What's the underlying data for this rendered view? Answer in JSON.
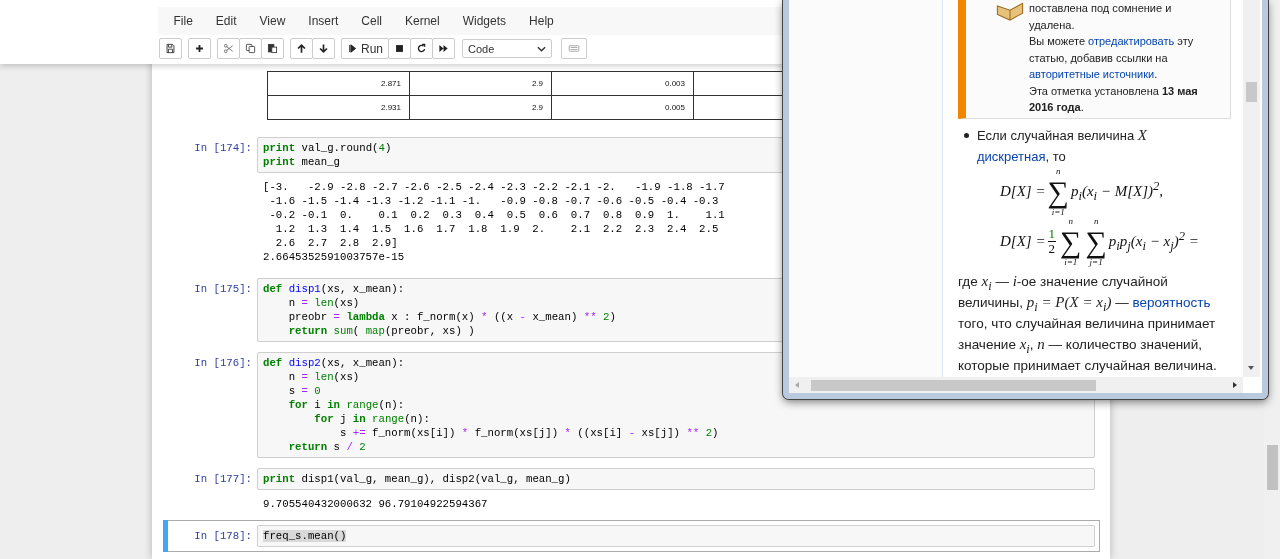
{
  "menu": [
    "File",
    "Edit",
    "View",
    "Insert",
    "Cell",
    "Kernel",
    "Widgets",
    "Help"
  ],
  "toolbar": {
    "groups": [
      [
        {
          "kind": "save"
        }
      ],
      [
        {
          "kind": "add"
        }
      ],
      [
        {
          "kind": "cut"
        },
        {
          "kind": "copy"
        },
        {
          "kind": "paste"
        }
      ],
      [
        {
          "kind": "up"
        },
        {
          "kind": "down"
        }
      ],
      [
        {
          "kind": "run",
          "label": "Run"
        },
        {
          "kind": "stop"
        },
        {
          "kind": "restart"
        },
        {
          "kind": "forward"
        }
      ]
    ],
    "cell_type": {
      "value": "Code"
    },
    "extra": [
      {
        "kind": "keyboard"
      }
    ]
  },
  "table": {
    "rows": [
      [
        "2.871",
        "2.9",
        "0.003"
      ],
      [
        "2.931",
        "2.9",
        "0.005"
      ]
    ]
  },
  "cells": [
    {
      "prompt": "In [174]:",
      "selected": false,
      "code": [
        [
          {
            "kind": "kw",
            "text": "print"
          },
          {
            "kind": "t",
            "text": " val_g.round("
          },
          {
            "kind": "num",
            "text": "4"
          },
          {
            "kind": "t",
            "text": ")"
          }
        ],
        [
          {
            "kind": "kw",
            "text": "print"
          },
          {
            "kind": "t",
            "text": " mean_g"
          }
        ]
      ],
      "output": [
        "[-3.   -2.9 -2.8 -2.7 -2.6 -2.5 -2.4 -2.3 -2.2 -2.1 -2.   -1.9 -1.8 -1.7",
        " -1.6 -1.5 -1.4 -1.3 -1.2 -1.1 -1.   -0.9 -0.8 -0.7 -0.6 -0.5 -0.4 -0.3",
        " -0.2 -0.1  0.    0.1  0.2  0.3  0.4  0.5  0.6  0.7  0.8  0.9  1.    1.1",
        "  1.2  1.3  1.4  1.5  1.6  1.7  1.8  1.9  2.    2.1  2.2  2.3  2.4  2.5",
        "  2.6  2.7  2.8  2.9]",
        "2.6645352591003757e-15"
      ]
    },
    {
      "prompt": "In [175]:",
      "selected": false,
      "code": [
        [
          {
            "kind": "kw",
            "text": "def "
          },
          {
            "kind": "fn",
            "text": "disp1"
          },
          {
            "kind": "t",
            "text": "(xs, x_mean):"
          }
        ],
        [
          {
            "kind": "t",
            "text": "    n "
          },
          {
            "kind": "op",
            "text": "= "
          },
          {
            "kind": "bi",
            "text": "len"
          },
          {
            "kind": "t",
            "text": "(xs)"
          }
        ],
        [
          {
            "kind": "t",
            "text": "    preobr "
          },
          {
            "kind": "op",
            "text": "= "
          },
          {
            "kind": "kw",
            "text": "lambda"
          },
          {
            "kind": "t",
            "text": " x : f_norm(x) "
          },
          {
            "kind": "op",
            "text": "*"
          },
          {
            "kind": "t",
            "text": " ((x "
          },
          {
            "kind": "op",
            "text": "-"
          },
          {
            "kind": "t",
            "text": " x_mean) "
          },
          {
            "kind": "op",
            "text": "** "
          },
          {
            "kind": "num",
            "text": "2"
          },
          {
            "kind": "t",
            "text": ")"
          }
        ],
        [
          {
            "kind": "kw",
            "text": "    return "
          },
          {
            "kind": "bi",
            "text": "sum"
          },
          {
            "kind": "t",
            "text": "( "
          },
          {
            "kind": "bi",
            "text": "map"
          },
          {
            "kind": "t",
            "text": "(preobr, xs) )"
          }
        ]
      ]
    },
    {
      "prompt": "In [176]:",
      "selected": false,
      "code": [
        [
          {
            "kind": "kw",
            "text": "def "
          },
          {
            "kind": "fn",
            "text": "disp2"
          },
          {
            "kind": "t",
            "text": "(xs, x_mean):"
          }
        ],
        [
          {
            "kind": "t",
            "text": "    n "
          },
          {
            "kind": "op",
            "text": "= "
          },
          {
            "kind": "bi",
            "text": "len"
          },
          {
            "kind": "t",
            "text": "(xs)"
          }
        ],
        [
          {
            "kind": "t",
            "text": "    s "
          },
          {
            "kind": "op",
            "text": "= "
          },
          {
            "kind": "num",
            "text": "0"
          }
        ],
        [
          {
            "kind": "kw",
            "text": "    for"
          },
          {
            "kind": "t",
            "text": " i "
          },
          {
            "kind": "kw",
            "text": "in "
          },
          {
            "kind": "bi",
            "text": "range"
          },
          {
            "kind": "t",
            "text": "(n):"
          }
        ],
        [
          {
            "kind": "kw",
            "text": "        for"
          },
          {
            "kind": "t",
            "text": " j "
          },
          {
            "kind": "kw",
            "text": "in "
          },
          {
            "kind": "bi",
            "text": "range"
          },
          {
            "kind": "t",
            "text": "(n):"
          }
        ],
        [
          {
            "kind": "t",
            "text": "            s "
          },
          {
            "kind": "op",
            "text": "+="
          },
          {
            "kind": "t",
            "text": " f_norm(xs[i]) "
          },
          {
            "kind": "op",
            "text": "*"
          },
          {
            "kind": "t",
            "text": " f_norm(xs[j]) "
          },
          {
            "kind": "op",
            "text": "*"
          },
          {
            "kind": "t",
            "text": " ((xs[i] "
          },
          {
            "kind": "op",
            "text": "-"
          },
          {
            "kind": "t",
            "text": " xs[j]) "
          },
          {
            "kind": "op",
            "text": "** "
          },
          {
            "kind": "num",
            "text": "2"
          },
          {
            "kind": "t",
            "text": ")"
          }
        ],
        [
          {
            "kind": "kw",
            "text": "    return"
          },
          {
            "kind": "t",
            "text": " s "
          },
          {
            "kind": "op",
            "text": "/ "
          },
          {
            "kind": "num",
            "text": "2"
          }
        ]
      ]
    },
    {
      "prompt": "In [177]:",
      "selected": false,
      "code": [
        [
          {
            "kind": "kw",
            "text": "print"
          },
          {
            "kind": "t",
            "text": " disp1(val_g, mean_g), disp2(val_g, mean_g)"
          }
        ]
      ],
      "output": [
        "9.705540432000632 96.79104922594367"
      ]
    },
    {
      "prompt": "In [178]:",
      "selected": true,
      "code": [
        [
          {
            "kind": "hl",
            "text": "freq_s.mean()"
          }
        ]
      ]
    }
  ],
  "article": {
    "notice": [
      [
        {
          "kind": "text",
          "text": "поставлена под сомнение и удалена."
        }
      ],
      [
        {
          "kind": "text",
          "text": "Вы можете "
        },
        {
          "kind": "link",
          "text": "отредактировать"
        },
        {
          "kind": "text",
          "text": " эту статью, добавив ссылки на "
        },
        {
          "kind": "link",
          "text": "авторитетные источники"
        },
        {
          "kind": "text",
          "text": "."
        }
      ],
      [
        {
          "kind": "text",
          "text": "Эта отметка установлена **13 мая 2016 года**."
        }
      ]
    ],
    "bullet": [
      {
        "kind": "text",
        "text": "Если случайная величина "
      },
      {
        "kind": "math",
        "text": "X "
      },
      {
        "kind": "link",
        "text": "дискретная"
      },
      {
        "kind": "text",
        "text": ", то"
      }
    ],
    "formulas": [
      [
        {
          "kind": "text",
          "text": "D[X] = "
        },
        {
          "kind": "sum",
          "symbol": "∑",
          "upper": "n",
          "lower": "i=1"
        },
        {
          "kind": "text",
          "text": "p$_{i}$(x$_{i}$ − M[X])$^{2}$,"
        }
      ],
      [
        {
          "kind": "text",
          "text": "D[X] = "
        },
        {
          "kind": "frac",
          "num": "1",
          "den": "2"
        },
        {
          "kind": "sum",
          "symbol": "∑",
          "upper": "n",
          "lower": "i=1"
        },
        {
          "kind": "sum",
          "symbol": "∑",
          "upper": "n",
          "lower": "j=1"
        },
        {
          "kind": "text",
          "text": "p$_{i}$p$_{j}$(x$_{i}$ − x$_{j}$)$^{2}$ ="
        }
      ]
    ],
    "paragraph": [
      {
        "kind": "text",
        "text": "где "
      },
      {
        "kind": "math",
        "text": "x$_{i}$"
      },
      {
        "kind": "text",
        "text": " — "
      },
      {
        "kind": "math",
        "text": "i"
      },
      {
        "kind": "text",
        "text": "-ое значение случайной величины, "
      },
      {
        "kind": "math",
        "text": "p$_{i}$ = P(X = x$_{i}$)"
      },
      {
        "kind": "text",
        "text": " — "
      },
      {
        "kind": "link",
        "text": "вероятность"
      },
      {
        "kind": "text",
        "text": " того, что случайная величина принимает значение "
      },
      {
        "kind": "math",
        "text": "x$_{i}$"
      },
      {
        "kind": "text",
        "text": ", "
      },
      {
        "kind": "math",
        "text": "n"
      },
      {
        "kind": "text",
        "text": " — количество значений, которые принимает случайная величина."
      }
    ]
  }
}
